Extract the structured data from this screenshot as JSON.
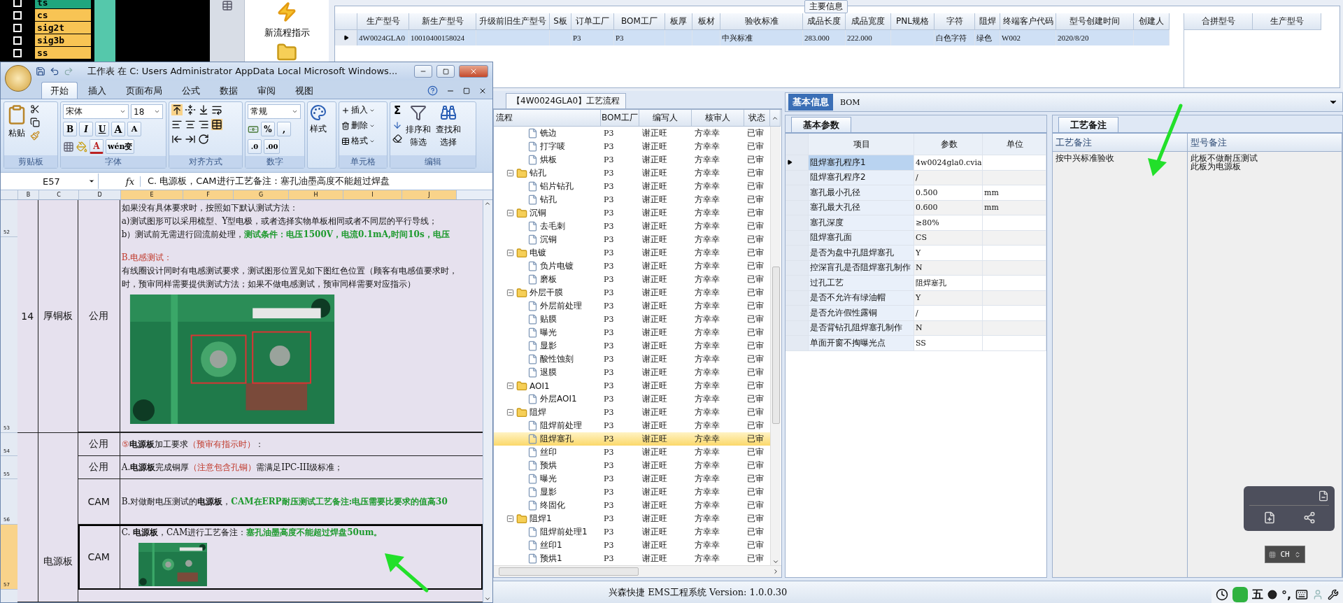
{
  "layers": [
    {
      "name": "ts",
      "color": "#1fa67e",
      "checked": false
    },
    {
      "name": "cs",
      "color": "#f8c454",
      "checked": false
    },
    {
      "name": "sig2t",
      "color": "#f8c454",
      "checked": false
    },
    {
      "name": "sig3b",
      "color": "#f8c454",
      "checked": false
    },
    {
      "name": "ss",
      "color": "#f8c454",
      "checked": false
    }
  ],
  "toolbar": {
    "new_flow": "新流程指示"
  },
  "main_info": {
    "title": "主要信息",
    "columns": [
      "生产型号",
      "新生产型号",
      "升级前旧生产型号",
      "S板",
      "订单工厂",
      "BOM工厂",
      "板厚",
      "板材",
      "验收标准",
      "成品长度",
      "成品宽度",
      "PNL规格",
      "字符",
      "阻焊",
      "终端客户代码",
      "型号创建时间",
      "创建人"
    ],
    "rows": [
      {
        "selected": true,
        "cells": [
          "4W0024GLA0",
          "10010400158024",
          null,
          null,
          "P3",
          "P3",
          null,
          null,
          "中兴标准",
          "283.000",
          "222.000",
          null,
          "白色字符",
          "绿色",
          "W002",
          "2020/8/20",
          null
        ]
      }
    ],
    "merge_columns": [
      "合拼型号",
      "生产型号"
    ]
  },
  "process": {
    "tab": "【4W0024GLA0】工艺流程",
    "columns": [
      "流程",
      "BOM工厂",
      "编写人",
      "核审人",
      "状态"
    ],
    "rows": [
      {
        "kind": "step",
        "label": "铣边",
        "selected": false,
        "bom": "P3",
        "writer": "谢正旺",
        "reviewer": "方幸幸",
        "status": "已审"
      },
      {
        "kind": "step",
        "label": "打字唛",
        "selected": false,
        "bom": "P3",
        "writer": "谢正旺",
        "reviewer": "方幸幸",
        "status": "已审"
      },
      {
        "kind": "step",
        "label": "烘板",
        "selected": false,
        "bom": "P3",
        "writer": "谢正旺",
        "reviewer": "方幸幸",
        "status": "已审"
      },
      {
        "kind": "group",
        "label": "钻孔",
        "expanded": true,
        "selected": false,
        "bom": "P3",
        "writer": "谢正旺",
        "reviewer": "方幸幸",
        "status": "已审",
        "children": [
          {
            "kind": "step",
            "label": "铝片钻孔",
            "selected": false,
            "bom": "P3",
            "writer": "谢正旺",
            "reviewer": "方幸幸",
            "status": "已审"
          },
          {
            "kind": "step",
            "label": "钻孔",
            "selected": false,
            "bom": "P3",
            "writer": "谢正旺",
            "reviewer": "方幸幸",
            "status": "已审"
          }
        ]
      },
      {
        "kind": "group",
        "label": "沉铜",
        "expanded": true,
        "selected": false,
        "bom": "P3",
        "writer": "谢正旺",
        "reviewer": "方幸幸",
        "status": "已审",
        "children": [
          {
            "kind": "step",
            "label": "去毛刺",
            "selected": false,
            "bom": "P3",
            "writer": "谢正旺",
            "reviewer": "方幸幸",
            "status": "已审"
          },
          {
            "kind": "step",
            "label": "沉铜",
            "selected": false,
            "bom": "P3",
            "writer": "谢正旺",
            "reviewer": "方幸幸",
            "status": "已审"
          }
        ]
      },
      {
        "kind": "group",
        "label": "电镀",
        "expanded": true,
        "selected": false,
        "bom": "P3",
        "writer": "谢正旺",
        "reviewer": "方幸幸",
        "status": "已审",
        "children": [
          {
            "kind": "step",
            "label": "负片电镀",
            "selected": false,
            "bom": "P3",
            "writer": "谢正旺",
            "reviewer": "方幸幸",
            "status": "已审"
          },
          {
            "kind": "step",
            "label": "磨板",
            "selected": false,
            "bom": "P3",
            "writer": "谢正旺",
            "reviewer": "方幸幸",
            "status": "已审"
          }
        ]
      },
      {
        "kind": "group",
        "label": "外层干膜",
        "expanded": true,
        "selected": false,
        "bom": "P3",
        "writer": "谢正旺",
        "reviewer": "方幸幸",
        "status": "已审",
        "children": [
          {
            "kind": "step",
            "label": "外层前处理",
            "selected": false,
            "bom": "P3",
            "writer": "谢正旺",
            "reviewer": "方幸幸",
            "status": "已审"
          },
          {
            "kind": "step",
            "label": "贴膜",
            "selected": false,
            "bom": "P3",
            "writer": "谢正旺",
            "reviewer": "方幸幸",
            "status": "已审"
          },
          {
            "kind": "step",
            "label": "曝光",
            "selected": false,
            "bom": "P3",
            "writer": "谢正旺",
            "reviewer": "方幸幸",
            "status": "已审"
          },
          {
            "kind": "step",
            "label": "显影",
            "selected": false,
            "bom": "P3",
            "writer": "谢正旺",
            "reviewer": "方幸幸",
            "status": "已审"
          },
          {
            "kind": "step",
            "label": "酸性蚀刻",
            "selected": false,
            "bom": "P3",
            "writer": "谢正旺",
            "reviewer": "方幸幸",
            "status": "已审"
          },
          {
            "kind": "step",
            "label": "退膜",
            "selected": false,
            "bom": "P3",
            "writer": "谢正旺",
            "reviewer": "方幸幸",
            "status": "已审"
          }
        ]
      },
      {
        "kind": "group",
        "label": "AOI1",
        "expanded": true,
        "selected": false,
        "bom": "P3",
        "writer": "谢正旺",
        "reviewer": "方幸幸",
        "status": "已审",
        "children": [
          {
            "kind": "step",
            "label": "外层AOI1",
            "selected": false,
            "bom": "P3",
            "writer": "谢正旺",
            "reviewer": "方幸幸",
            "status": "已审"
          }
        ]
      },
      {
        "kind": "group",
        "label": "阻焊",
        "expanded": true,
        "selected": false,
        "bom": "P3",
        "writer": "谢正旺",
        "reviewer": "方幸幸",
        "status": "已审",
        "children": [
          {
            "kind": "step",
            "label": "阻焊前处理",
            "selected": false,
            "bom": "P3",
            "writer": "谢正旺",
            "reviewer": "方幸幸",
            "status": "已审"
          },
          {
            "kind": "step",
            "label": "阻焊塞孔",
            "selected": true,
            "bom": "P3",
            "writer": "谢正旺",
            "reviewer": "方幸幸",
            "status": "已审"
          },
          {
            "kind": "step",
            "label": "丝印",
            "selected": false,
            "bom": "P3",
            "writer": "谢正旺",
            "reviewer": "方幸幸",
            "status": "已审"
          },
          {
            "kind": "step",
            "label": "预烘",
            "selected": false,
            "bom": "P3",
            "writer": "谢正旺",
            "reviewer": "方幸幸",
            "status": "已审"
          },
          {
            "kind": "step",
            "label": "曝光",
            "selected": false,
            "bom": "P3",
            "writer": "谢正旺",
            "reviewer": "方幸幸",
            "status": "已审"
          },
          {
            "kind": "step",
            "label": "显影",
            "selected": false,
            "bom": "P3",
            "writer": "谢正旺",
            "reviewer": "方幸幸",
            "status": "已审"
          },
          {
            "kind": "step",
            "label": "终固化",
            "selected": false,
            "bom": "P3",
            "writer": "谢正旺",
            "reviewer": "方幸幸",
            "status": "已审"
          }
        ]
      },
      {
        "kind": "group",
        "label": "阻焊1",
        "expanded": true,
        "selected": false,
        "bom": "P3",
        "writer": "谢正旺",
        "reviewer": "方幸幸",
        "status": "已审",
        "children": [
          {
            "kind": "step",
            "label": "阻焊前处理1",
            "selected": false,
            "bom": "P3",
            "writer": "谢正旺",
            "reviewer": "方幸幸",
            "status": "已审"
          },
          {
            "kind": "step",
            "label": "丝印1",
            "selected": false,
            "bom": "P3",
            "writer": "谢正旺",
            "reviewer": "方幸幸",
            "status": "已审"
          },
          {
            "kind": "step",
            "label": "预烘1",
            "selected": false,
            "bom": "P3",
            "writer": "谢正旺",
            "reviewer": "方幸幸",
            "status": "已审"
          }
        ]
      }
    ]
  },
  "info": {
    "tabs": [
      {
        "label": "基本信息",
        "selected": true
      },
      {
        "label": "BOM",
        "selected": false
      }
    ],
    "params": {
      "tab": "基本参数",
      "columns": [
        "项目",
        "参数",
        "单位"
      ],
      "rows": [
        {
          "item": "阻焊塞孔程序1",
          "value": "4w0024gla0.cvia",
          "selected": true
        },
        {
          "item": "阻焊塞孔程序2",
          "value": "/",
          "selected": false
        },
        {
          "item": "塞孔最小孔径",
          "value": "0.500",
          "unit": "mm",
          "selected": false
        },
        {
          "item": "塞孔最大孔径",
          "value": "0.600",
          "unit": "mm",
          "selected": false
        },
        {
          "item": "塞孔深度",
          "value": "≥80%",
          "selected": false
        },
        {
          "item": "阻焊塞孔面",
          "value": "CS",
          "selected": false
        },
        {
          "item": "是否为盘中孔阻焊塞孔",
          "value": "Y",
          "selected": false
        },
        {
          "item": "控深盲孔是否阻焊塞孔制作",
          "value": "N",
          "selected": false
        },
        {
          "item": "过孔工艺",
          "value": "阻焊塞孔",
          "selected": false
        },
        {
          "item": "是否不允许有绿油帽",
          "value": "Y",
          "selected": false
        },
        {
          "item": "是否允许假性露铜",
          "value": "/",
          "selected": false
        },
        {
          "item": "是否背钻孔阻焊塞孔制作",
          "value": "N",
          "selected": false
        },
        {
          "item": "单面开窗不掏曝光点",
          "value": "SS",
          "selected": false
        }
      ]
    },
    "notes": {
      "tab": "工艺备注",
      "columns": [
        "工艺备注",
        "型号备注"
      ],
      "process_note": [
        "按中兴标准验收"
      ],
      "model_note": [
        "此板不做耐压测试",
        "此板为电源板"
      ]
    }
  },
  "status_bar": {
    "text": "兴森快捷  EMS工程系统  Version: 1.0.0.30"
  },
  "input_widget": {
    "label": "CH"
  },
  "tray": {
    "ime": "五",
    "punct": "°,"
  },
  "excel": {
    "title": "工作表 在 C: Users Administrator AppData Local Microsoft Windows...",
    "tabs": [
      {
        "label": "开始",
        "selected": true
      },
      {
        "label": "插入",
        "selected": false
      },
      {
        "label": "页面布局",
        "selected": false
      },
      {
        "label": "公式",
        "selected": false
      },
      {
        "label": "数据",
        "selected": false
      },
      {
        "label": "审阅",
        "selected": false
      },
      {
        "label": "视图",
        "selected": false
      }
    ],
    "ribbon": {
      "clipboard": {
        "label": "剪贴板",
        "paste": "粘贴"
      },
      "font": {
        "label": "字体",
        "font": "宋体",
        "size": "18",
        "styles": [
          "B",
          "I",
          "U"
        ],
        "grow": [
          "A",
          "A"
        ],
        "color_letter": "A",
        "phonetic": "wén变"
      },
      "align": {
        "label": "对齐方式"
      },
      "number": {
        "label": "数字",
        "format": "常规",
        "symbols": [
          "%",
          ","
        ],
        "decimals": [
          ".0",
          ".00"
        ]
      },
      "styles": {
        "button": "样式"
      },
      "cells": {
        "label": "单元格",
        "buttons": [
          "插入",
          "删除",
          "格式"
        ]
      },
      "editing": {
        "label": "编辑",
        "sum": "Σ",
        "buttons": [
          "排序和筛选",
          "查找和选择"
        ]
      }
    },
    "name_box": "E57",
    "fx": "fx",
    "formula": "C. 电源板，CAM进行工艺备注：塞孔油墨高度不能超过焊盘",
    "columns": [
      {
        "label": "B",
        "selected": false
      },
      {
        "label": "C",
        "selected": false
      },
      {
        "label": "D",
        "selected": false
      },
      {
        "label": "E",
        "selected": true
      },
      {
        "label": "F",
        "selected": true
      },
      {
        "label": "G",
        "selected": true
      },
      {
        "label": "H",
        "selected": true
      },
      {
        "label": "I",
        "selected": true
      },
      {
        "label": "J",
        "selected": true
      }
    ],
    "row_numbers": [
      {
        "label": "52",
        "selected": false
      },
      {
        "label": "53",
        "selected": false
      },
      {
        "label": "54",
        "selected": false
      },
      {
        "label": "55",
        "selected": false
      },
      {
        "label": "56",
        "selected": false
      },
      {
        "label": "57",
        "selected": true
      }
    ],
    "groups": [
      {
        "no": "14",
        "category": "厚铜板",
        "lines": [
          {
            "scope": "公用",
            "picture": true,
            "paragraphs": [
              [
                {
                  "kind": "plain",
                  "text": "如果没有具体要求时，按照如下默认测试方法："
                }
              ],
              [
                {
                  "kind": "plain",
                  "text": "a)测试图形可以采用梳型、Y型电极，或者选择实物单板相同或者不同层的平行导线；"
                }
              ],
              [
                {
                  "kind": "plain",
                  "text": "b）测试前无需进行回流前处理，"
                },
                {
                  "kind": "green",
                  "text": "测试条件：电压1500V，电流0.1mA,时间10s，电压"
                }
              ],
              [
                {
                  "kind": "red",
                  "text": "B.电感测试："
                }
              ],
              [
                {
                  "kind": "plain",
                  "text": "有线圈设计同时有电感测试要求，测试图形位置见如下图红色位置（顾客有电感值要求时，"
                }
              ],
              [
                {
                  "kind": "plain",
                  "text": "时，预审同样需要提供测试方法；如果不做电感测试，预审同样需要对应指示）"
                }
              ]
            ]
          }
        ]
      },
      {
        "category": "电源板",
        "lines": [
          {
            "scope": "公用",
            "paragraphs": [
              [
                {
                  "kind": "red",
                  "text": "⑤"
                },
                {
                  "kind": "bold",
                  "text": "电源板"
                },
                {
                  "kind": "plain",
                  "text": "加工要求"
                },
                {
                  "kind": "red",
                  "text": "（预审有指示时）"
                },
                {
                  "kind": "plain",
                  "text": "："
                }
              ]
            ]
          },
          {
            "scope": "公用",
            "paragraphs": [
              [
                {
                  "kind": "plain",
                  "text": "A."
                },
                {
                  "kind": "bold",
                  "text": "电源板"
                },
                {
                  "kind": "plain",
                  "text": "完成铜厚"
                },
                {
                  "kind": "red",
                  "text": "（注意包含孔铜）"
                },
                {
                  "kind": "plain",
                  "text": "需满足IPC-III级标准；"
                }
              ]
            ]
          },
          {
            "scope": "CAM",
            "paragraphs": [
              [
                {
                  "kind": "plain",
                  "text": "B.对做耐电压测试的"
                },
                {
                  "kind": "bold",
                  "text": "电源板"
                },
                {
                  "kind": "plain",
                  "text": "，"
                },
                {
                  "kind": "green",
                  "text": "CAM在ERP耐压测试工艺备注:电压需要比要求的值高30"
                }
              ]
            ]
          },
          {
            "scope": "CAM",
            "selected": true,
            "picture": true,
            "paragraphs": [
              [
                {
                  "kind": "plain",
                  "text": "C. "
                },
                {
                  "kind": "bold",
                  "text": "电源板"
                },
                {
                  "kind": "plain",
                  "text": "，CAM进行工艺备注："
                },
                {
                  "kind": "green",
                  "text": "塞孔油墨高度不能超过焊盘50um。"
                }
              ]
            ]
          }
        ]
      }
    ]
  }
}
